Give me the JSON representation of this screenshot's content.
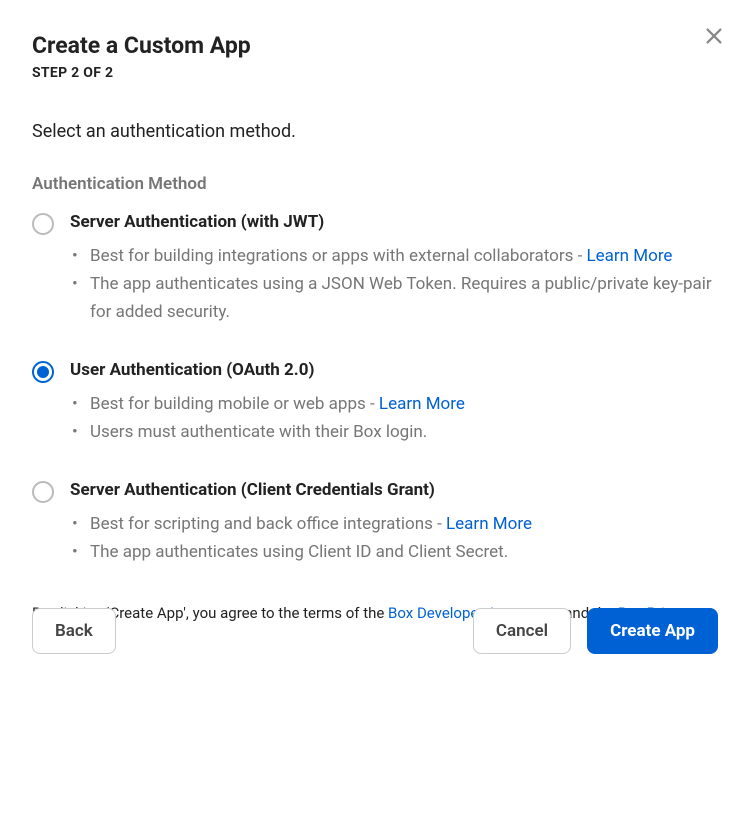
{
  "header": {
    "title": "Create a Custom App",
    "step": "STEP 2 OF 2"
  },
  "prompt": "Select an authentication method.",
  "section_label": "Authentication Method",
  "options": [
    {
      "title": "Server Authentication (with JWT)",
      "selected": false,
      "bullets": [
        {
          "text": "Best for building integrations or apps with external collaborators - ",
          "link": "Learn More"
        },
        {
          "text": "The app authenticates using a JSON Web Token. Requires a public/private key-pair for added security."
        }
      ]
    },
    {
      "title": "User Authentication (OAuth 2.0)",
      "selected": true,
      "bullets": [
        {
          "text": "Best for building mobile or web apps - ",
          "link": "Learn More"
        },
        {
          "text": "Users must authenticate with their Box login."
        }
      ]
    },
    {
      "title": "Server Authentication (Client Credentials Grant)",
      "selected": false,
      "bullets": [
        {
          "text": "Best for scripting and back office integrations - ",
          "link": "Learn More"
        },
        {
          "text": "The app authenticates using Client ID and Client Secret."
        }
      ]
    }
  ],
  "agreement": {
    "pre": "By clicking 'Create App', you agree to the terms of the ",
    "link1": "Box Developer Agreement",
    "mid": " and the ",
    "link2": "Box Privacy Policy",
    "post": "."
  },
  "buttons": {
    "back": "Back",
    "cancel": "Cancel",
    "create": "Create App"
  }
}
